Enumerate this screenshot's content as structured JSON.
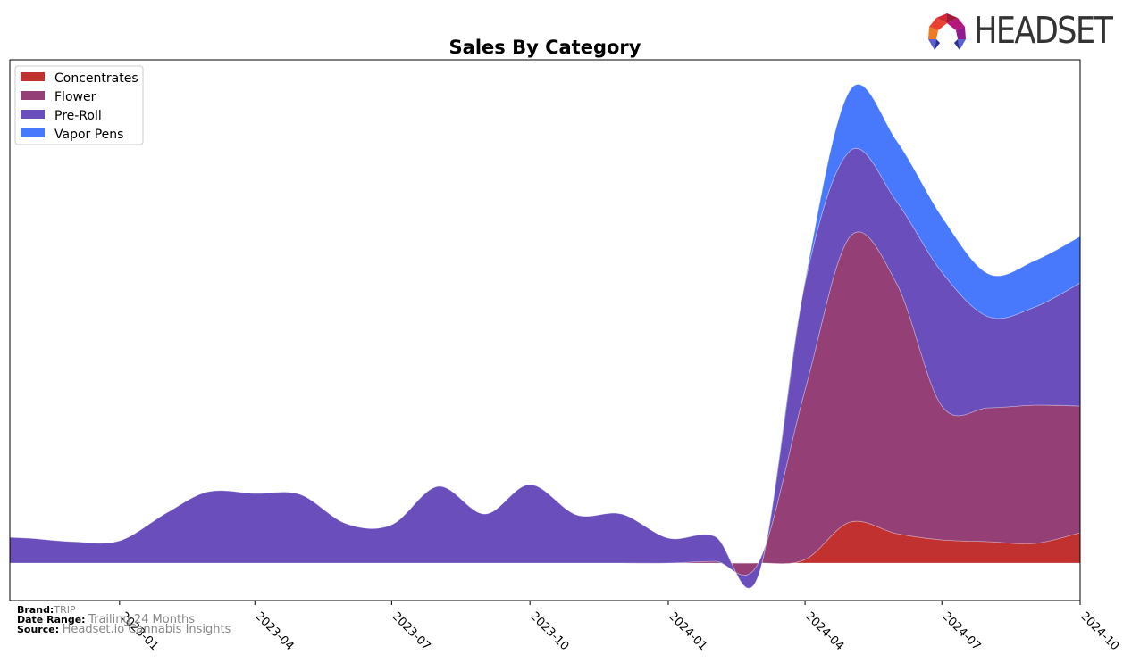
{
  "chart_data": {
    "type": "area",
    "stacked": true,
    "smoothed": true,
    "title": "Sales By Category",
    "xlabel": "",
    "ylabel": "",
    "x": [
      "2022-10",
      "2022-11",
      "2022-12",
      "2023-01",
      "2023-02",
      "2023-03",
      "2023-04",
      "2023-05",
      "2023-06",
      "2023-07",
      "2023-08",
      "2023-09",
      "2023-10",
      "2023-11",
      "2023-12",
      "2024-01",
      "2024-02",
      "2024-03",
      "2024-04",
      "2024-05",
      "2024-06",
      "2024-07",
      "2024-08",
      "2024-09",
      "2024-10"
    ],
    "x_ticks": [
      "2023-01",
      "2023-04",
      "2023-07",
      "2023-10",
      "2024-01",
      "2024-04",
      "2024-07",
      "2024-10"
    ],
    "xlim": [
      "2022-10-20",
      "2024-10-01"
    ],
    "ylim": [
      -42,
      564
    ],
    "grid": false,
    "legend_position": "top-left",
    "series": [
      {
        "name": "Concentrates",
        "color": "#c0312f",
        "values": [
          0,
          0,
          0,
          0,
          0,
          0,
          0,
          0,
          0,
          0,
          0,
          0,
          0,
          0,
          0,
          0,
          0,
          0,
          4,
          46,
          33,
          26,
          24,
          22,
          34
        ]
      },
      {
        "name": "Flower",
        "color": "#943f76",
        "values": [
          0,
          0,
          0,
          0,
          0,
          0,
          0,
          0,
          0,
          0,
          0,
          0,
          0,
          0,
          0,
          0,
          2,
          0,
          190,
          320,
          280,
          150,
          150,
          155,
          142
        ]
      },
      {
        "name": "Pre-Roll",
        "color": "#6a4ebc",
        "values": [
          30,
          28,
          24,
          25,
          56,
          80,
          78,
          77,
          44,
          43,
          86,
          55,
          88,
          54,
          55,
          28,
          28,
          -14,
          120,
          96,
          92,
          150,
          102,
          110,
          138
        ]
      },
      {
        "name": "Vapor Pens",
        "color": "#4878fc",
        "values": [
          0,
          0,
          0,
          0,
          0,
          0,
          0,
          0,
          0,
          0,
          0,
          0,
          0,
          0,
          0,
          0,
          0,
          0,
          2,
          68,
          68,
          62,
          48,
          52,
          52
        ]
      }
    ]
  },
  "legend": {
    "items": [
      {
        "label": "Concentrates",
        "color": "#c0312f"
      },
      {
        "label": "Flower",
        "color": "#943f76"
      },
      {
        "label": "Pre-Roll",
        "color": "#6a4ebc"
      },
      {
        "label": "Vapor Pens",
        "color": "#4878fc"
      }
    ]
  },
  "footer": {
    "brand_key": "Brand:",
    "brand_value": "TRIP",
    "date_range_key": "Date Range:",
    "date_range_value": "Trailing 24 Months",
    "source_key": "Source:",
    "source_value": "Headset.io Cannabis Insights"
  },
  "logo": {
    "text": "HEADSET"
  }
}
